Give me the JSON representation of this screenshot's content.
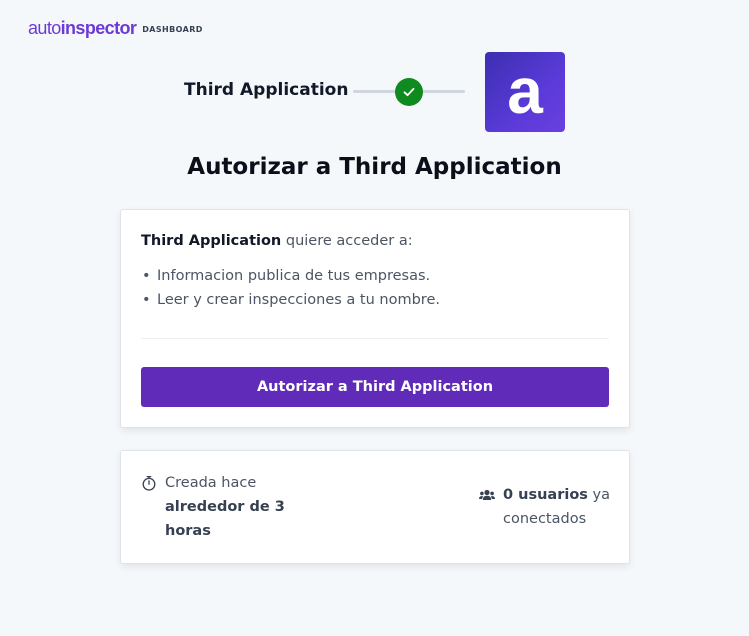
{
  "brand": {
    "auto": "auto",
    "inspector": "inspector",
    "section": "DASHBOARD"
  },
  "connection": {
    "app_name": "Third Application",
    "app_logo_letter": "a",
    "status_icon": "check-icon"
  },
  "title": "Autorizar a Third Application",
  "request": {
    "app_name": "Third Application",
    "suffix": " quiere acceder a:",
    "permissions": [
      "Informacion publica de tus empresas.",
      "Leer y crear inspecciones a tu nombre."
    ],
    "button_label": "Autorizar a Third Application"
  },
  "info": {
    "created_prefix": "Creada hace",
    "created_value": "alrededor de 3 horas",
    "users_count": "0 usuarios",
    "users_suffix": " ya conectados"
  },
  "colors": {
    "accent": "#5f2bb8",
    "brand": "#6d3ad6",
    "success": "#0f8a1f",
    "background": "#f5f8fb"
  }
}
